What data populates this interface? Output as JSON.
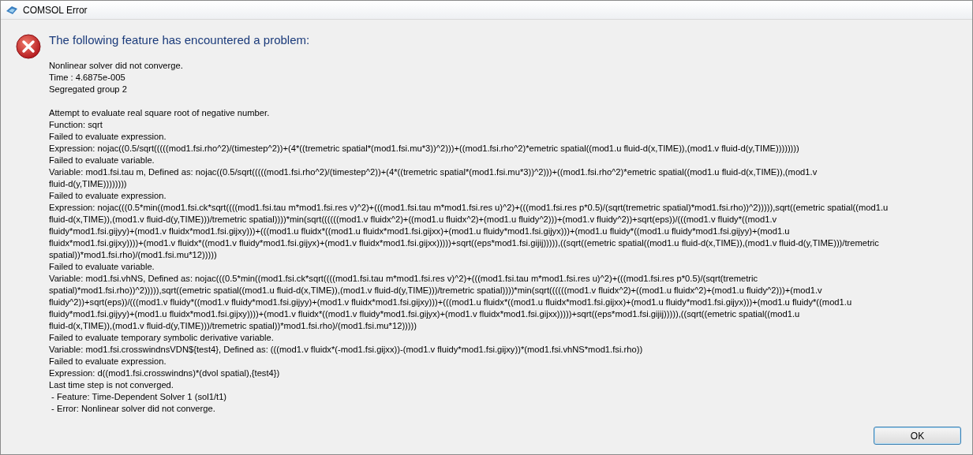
{
  "window": {
    "title": "COMSOL Error"
  },
  "heading": "The following feature has encountered a problem:",
  "message_blocks": [
    [
      "Nonlinear solver did not converge.",
      "Time : 4.6875e-005",
      "Segregated group 2"
    ],
    [
      "Attempt to evaluate real square root of negative number.",
      "Function: sqrt",
      "Failed to evaluate expression.",
      "Expression: nojac((0.5/sqrt(((((mod1.fsi.rho^2)/(timestep^2))+(4*((tremetric spatial*(mod1.fsi.mu*3))^2)))+((mod1.fsi.rho^2)*emetric spatial((mod1.u fluid-d(x,TIME)),(mod1.v fluid-d(y,TIME))))))))",
      "Failed to evaluate variable.",
      "Variable: mod1.fsi.tau m, Defined as: nojac((0.5/sqrt(((((mod1.fsi.rho^2)/(timestep^2))+(4*((tremetric spatial*(mod1.fsi.mu*3))^2)))+((mod1.fsi.rho^2)*emetric spatial((mod1.u fluid-d(x,TIME)),(mod1.v",
      "fluid-d(y,TIME))))))))",
      "Failed to evaluate expression.",
      "Expression: nojac(((0.5*min((mod1.fsi.ck*sqrt((((mod1.fsi.tau m*mod1.fsi.res v)^2)+(((mod1.fsi.tau m*mod1.fsi.res u)^2)+(((mod1.fsi.res p*0.5)/(sqrt(tremetric spatial)*mod1.fsi.rho))^2))))),sqrt((emetric spatial((mod1.u",
      "fluid-d(x,TIME)),(mod1.v fluid-d(y,TIME)))/tremetric spatial))))*min(sqrt((((((mod1.v fluidx^2)+((mod1.u fluidx^2)+(mod1.u fluidy^2)))+(mod1.v fluidy^2))+sqrt(eps))/(((mod1.v fluidy*((mod1.v",
      "fluidy*mod1.fsi.gijyy)+(mod1.v fluidx*mod1.fsi.gijxy)))+(((mod1.u fluidx*((mod1.u fluidx*mod1.fsi.gijxx)+(mod1.u fluidy*mod1.fsi.gijyx)))+(mod1.u fluidy*((mod1.u fluidy*mod1.fsi.gijyy)+(mod1.u",
      "fluidx*mod1.fsi.gijxy))))+(mod1.v fluidx*((mod1.v fluidy*mod1.fsi.gijyx)+(mod1.v fluidx*mod1.fsi.gijxx)))))+sqrt((eps*mod1.fsi.gijij))))),((sqrt((emetric spatial((mod1.u fluid-d(x,TIME)),(mod1.v fluid-d(y,TIME)))/tremetric",
      "spatial))*mod1.fsi.rho)/(mod1.fsi.mu*12)))))",
      "Failed to evaluate variable.",
      "Variable: mod1.fsi.vhNS, Defined as: nojac(((0.5*min((mod1.fsi.ck*sqrt((((mod1.fsi.tau m*mod1.fsi.res v)^2)+(((mod1.fsi.tau m*mod1.fsi.res u)^2)+(((mod1.fsi.res p*0.5)/(sqrt(tremetric",
      "spatial)*mod1.fsi.rho))^2))))),sqrt((emetric spatial((mod1.u fluid-d(x,TIME)),(mod1.v fluid-d(y,TIME)))/tremetric spatial))))*min(sqrt((((((mod1.v fluidx^2)+((mod1.u fluidx^2)+(mod1.u fluidy^2)))+(mod1.v",
      "fluidy^2))+sqrt(eps))/(((mod1.v fluidy*((mod1.v fluidy*mod1.fsi.gijyy)+(mod1.v fluidx*mod1.fsi.gijxy)))+(((mod1.u fluidx*((mod1.u fluidx*mod1.fsi.gijxx)+(mod1.u fluidy*mod1.fsi.gijyx)))+(mod1.u fluidy*((mod1.u",
      "fluidy*mod1.fsi.gijyy)+(mod1.u fluidx*mod1.fsi.gijxy))))+(mod1.v fluidx*((mod1.v fluidy*mod1.fsi.gijyx)+(mod1.v fluidx*mod1.fsi.gijxx)))))+sqrt((eps*mod1.fsi.gijij))))),((sqrt((emetric spatial((mod1.u",
      "fluid-d(x,TIME)),(mod1.v fluid-d(y,TIME)))/tremetric spatial))*mod1.fsi.rho)/(mod1.fsi.mu*12)))))",
      "Failed to evaluate temporary symbolic derivative variable.",
      "Variable: mod1.fsi.crosswindnsVDN${test4}, Defined as: (((mod1.v fluidx*(-mod1.fsi.gijxx))-(mod1.v fluidy*mod1.fsi.gijxy))*(mod1.fsi.vhNS*mod1.fsi.rho))",
      "Failed to evaluate expression.",
      "Expression: d((mod1.fsi.crosswindns)*(dvol spatial),{test4})",
      "Last time step is not converged.",
      " - Feature: Time-Dependent Solver 1 (sol1/t1)",
      " - Error: Nonlinear solver did not converge."
    ]
  ],
  "buttons": [
    {
      "label": "OK",
      "default": true
    }
  ]
}
